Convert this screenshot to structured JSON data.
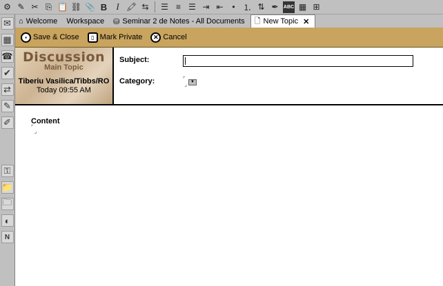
{
  "toolbar": {
    "icons": [
      "smart-icon",
      "edit-icon",
      "cut-icon",
      "copy-icon",
      "paste-icon",
      "link-icon",
      "attach-icon",
      "bold-icon",
      "italic-icon",
      "highlight-icon",
      "text-color-icon",
      "align-left-icon",
      "align-center-icon",
      "align-right-icon",
      "indent-icon",
      "outdent-icon",
      "bullets-icon",
      "numbers-icon",
      "outline-icon",
      "hotspot-icon",
      "spell-icon",
      "table-icon",
      "insert-table-icon"
    ]
  },
  "tabs": [
    {
      "label": "Welcome",
      "icon": "home-icon"
    },
    {
      "label": "Workspace",
      "icon": ""
    },
    {
      "label": "Seminar 2 de Notes - All Documents",
      "icon": "database-icon"
    },
    {
      "label": "New Topic",
      "icon": "document-icon",
      "active": true
    }
  ],
  "actions": {
    "save_close": "Save & Close",
    "mark_private": "Mark Private",
    "cancel": "Cancel"
  },
  "header": {
    "logo_title": "Discussion",
    "logo_subtitle": "Main Topic",
    "author": "Tiberiu Vasilica/Tibbs/RO",
    "timestamp": "Today 09:55 AM",
    "subject_label": "Subject:",
    "subject_value": "",
    "category_label": "Category:"
  },
  "body": {
    "content_label": "Content"
  }
}
